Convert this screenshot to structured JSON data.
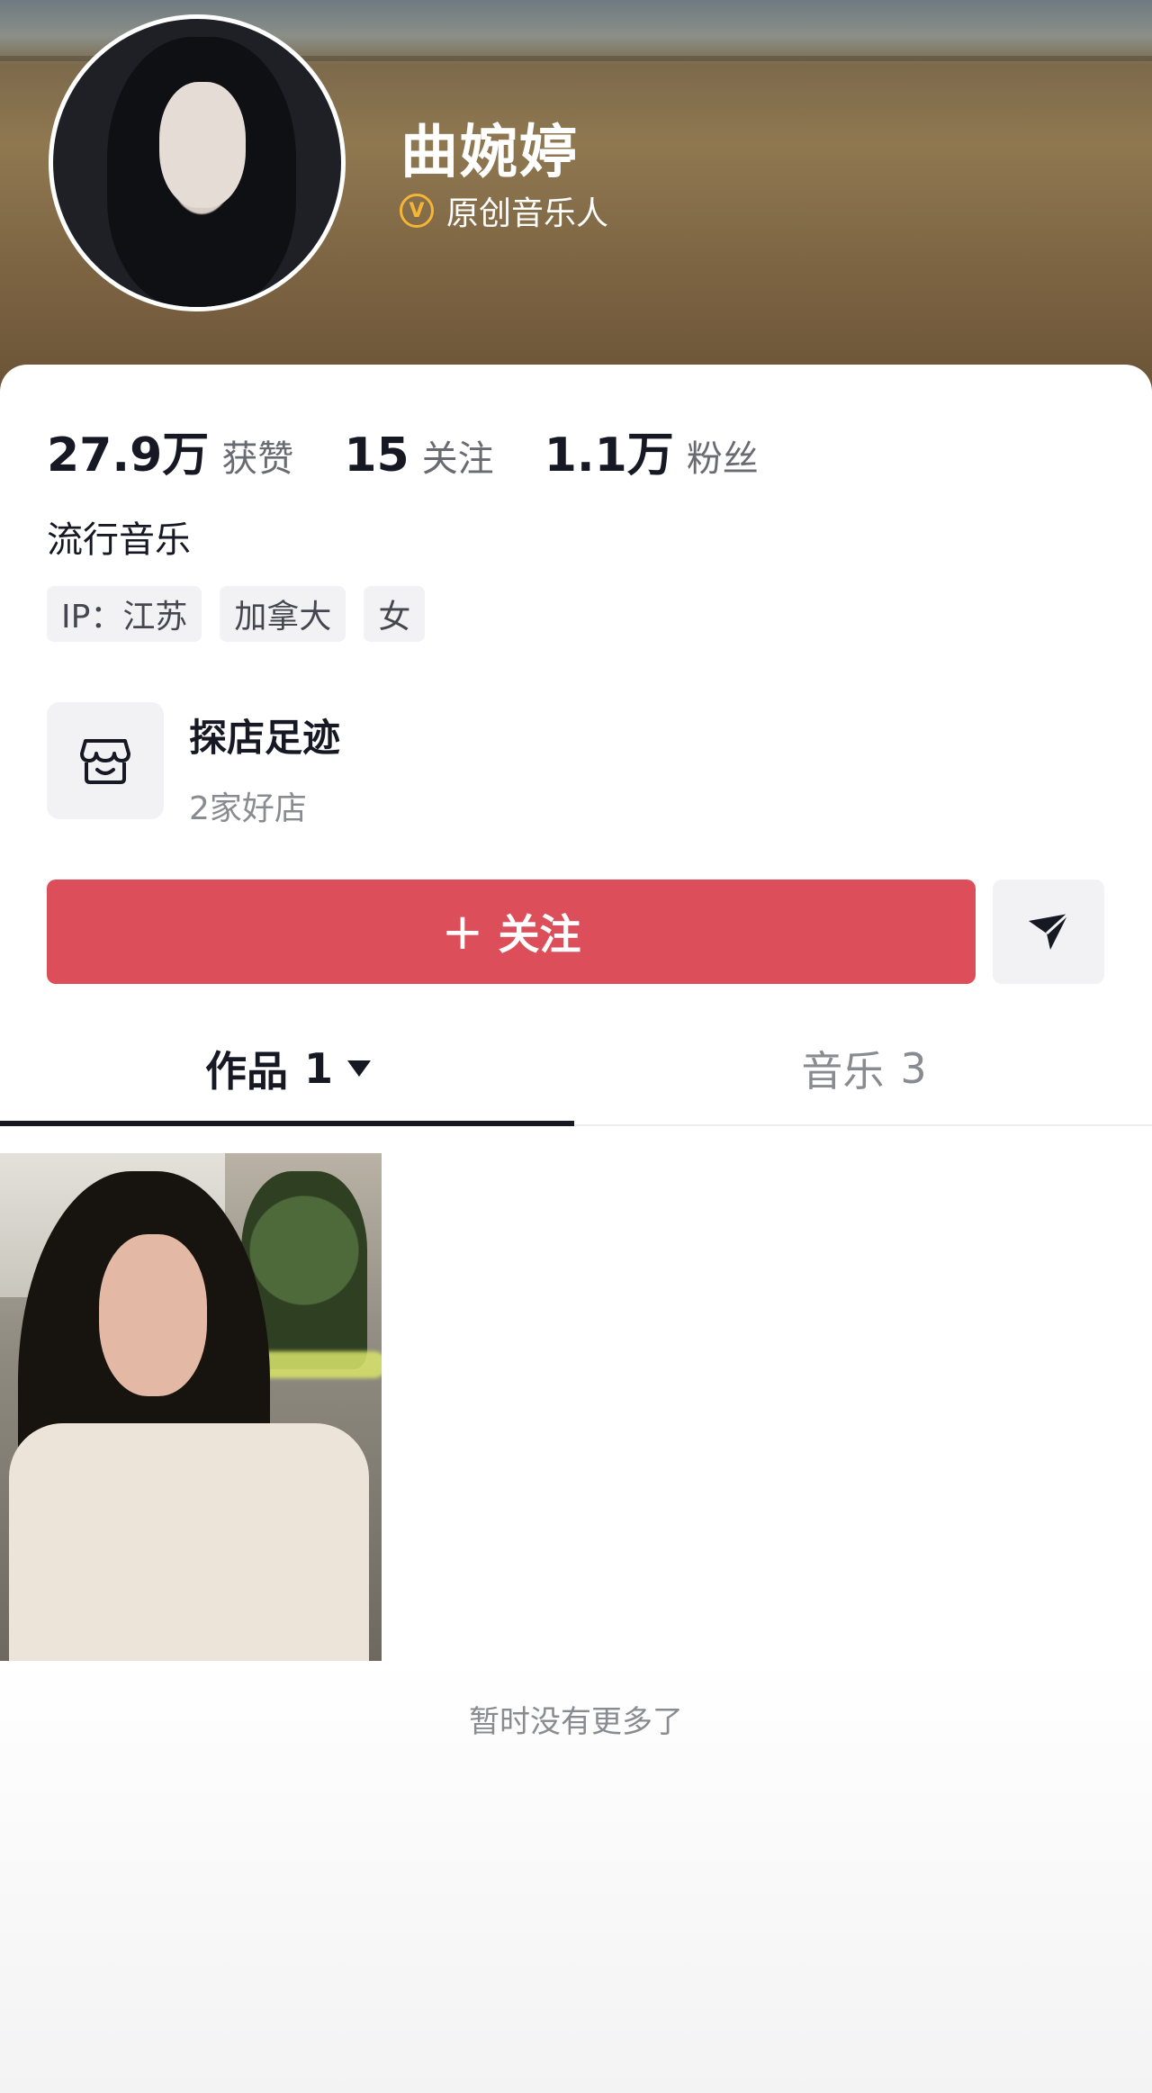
{
  "profile": {
    "name": "曲婉婷",
    "verification_label": "原创音乐人",
    "verification_badge_text": "V"
  },
  "stats": [
    {
      "value": "27.9万",
      "label": "获赞"
    },
    {
      "value": "15",
      "label": "关注"
    },
    {
      "value": "1.1万",
      "label": "粉丝"
    }
  ],
  "bio": "流行音乐",
  "tags": [
    "IP：江苏",
    "加拿大",
    "女"
  ],
  "shop": {
    "title": "探店足迹",
    "subtitle": "2家好店"
  },
  "actions": {
    "follow_plus": "+",
    "follow_label": "关注"
  },
  "tabs": [
    {
      "label": "作品",
      "count": "1",
      "active": true
    },
    {
      "label": "音乐",
      "count": "3",
      "active": false
    }
  ],
  "footer": {
    "no_more_text": "暂时没有更多了"
  },
  "colors": {
    "follow_button": "#dd4e5b",
    "verify_badge": "#f5b637"
  },
  "icons": [
    "verified-v-icon",
    "store-icon",
    "share-send-icon",
    "dropdown-caret-icon"
  ]
}
